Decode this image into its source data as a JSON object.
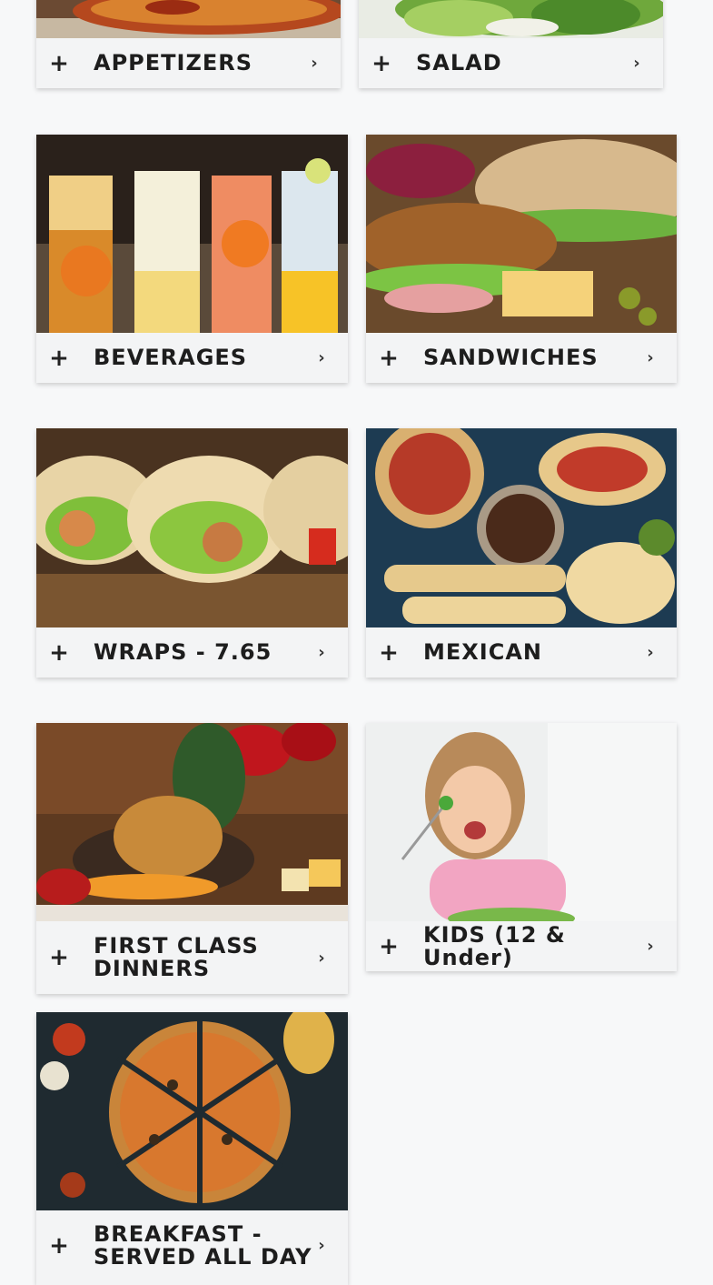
{
  "menu": {
    "categories": [
      {
        "label": "APPETIZERS",
        "image": "toasted-bread-appetizer-photo"
      },
      {
        "label": "SALAD",
        "image": "green-salad-photo"
      },
      {
        "label": "BEVERAGES",
        "image": "iced-drinks-photo"
      },
      {
        "label": "SANDWICHES",
        "image": "sub-sandwiches-photo"
      },
      {
        "label": "WRAPS - 7.65",
        "image": "chicken-wraps-photo"
      },
      {
        "label": "MEXICAN",
        "image": "mexican-food-spread-photo"
      },
      {
        "label": "FIRST CLASS DINNERS",
        "image": "roast-chicken-dinner-photo"
      },
      {
        "label": "KIDS (12 & Under)",
        "image": "girl-eating-salad-photo"
      },
      {
        "label": "BREAKFAST - SERVED ALL DAY",
        "image": "pizza-photo"
      }
    ],
    "expand_icon": "plus-icon",
    "open_icon": "chevron-right-icon",
    "plus_glyph": "+",
    "chevron_glyph": "›"
  }
}
